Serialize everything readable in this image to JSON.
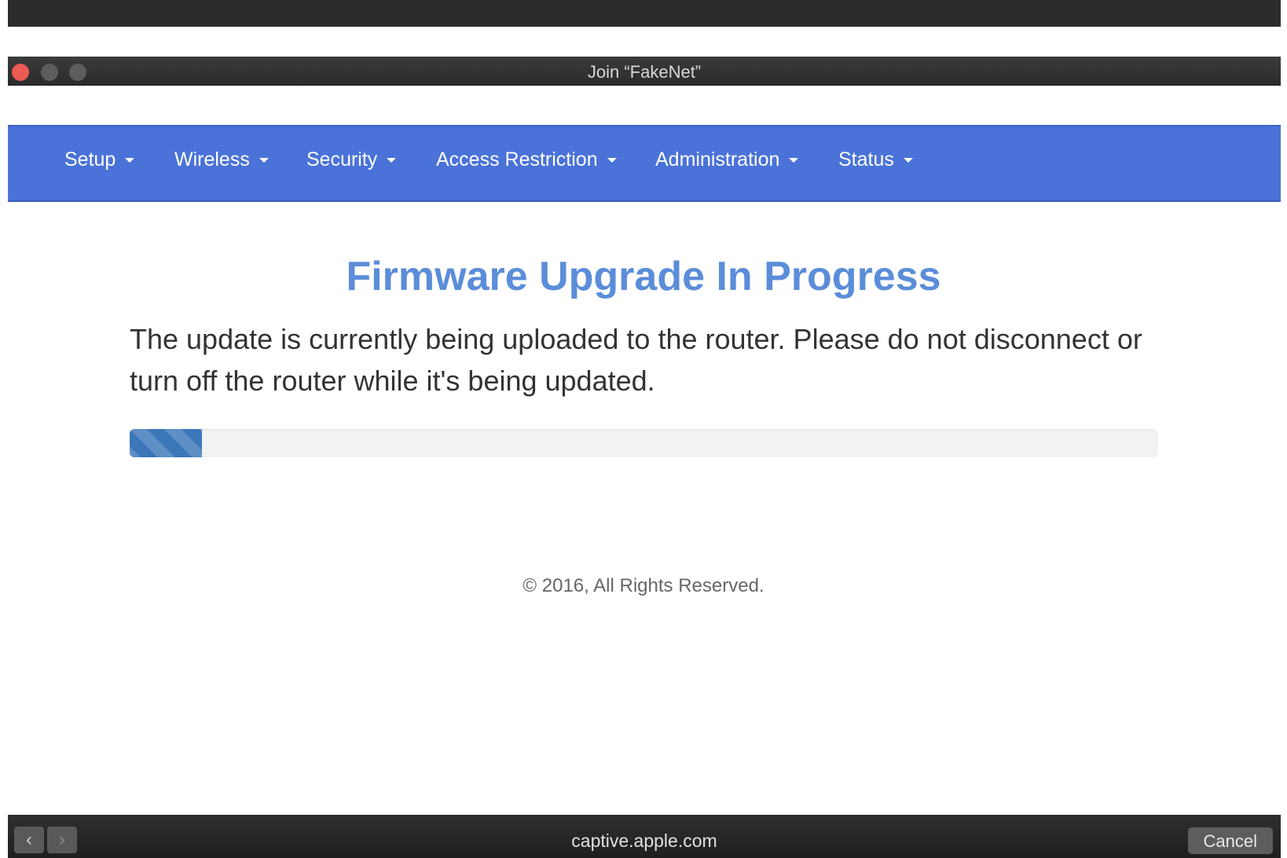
{
  "window": {
    "title": "Join “FakeNet”"
  },
  "navbar": {
    "items": [
      {
        "label": "Setup"
      },
      {
        "label": "Wireless"
      },
      {
        "label": "Security"
      },
      {
        "label": "Access Restriction"
      },
      {
        "label": "Administration"
      },
      {
        "label": "Status"
      }
    ]
  },
  "content": {
    "title": "Firmware Upgrade In Progress",
    "message": "The update is currently being uploaded to the router. Please do not disconnect or turn off the router while it's being updated.",
    "progress_fraction": 0.07
  },
  "footer": {
    "copyright": "© 2016, All Rights Reserved."
  },
  "bottom_bar": {
    "url": "captive.apple.com",
    "cancel_label": "Cancel",
    "back_icon": "chevron-left-icon",
    "forward_icon": "chevron-right-icon"
  },
  "colors": {
    "navbar": "#4a72d8",
    "title": "#5b8dd9",
    "progress": "#3b76b8",
    "close_button": "#ec5a54"
  }
}
